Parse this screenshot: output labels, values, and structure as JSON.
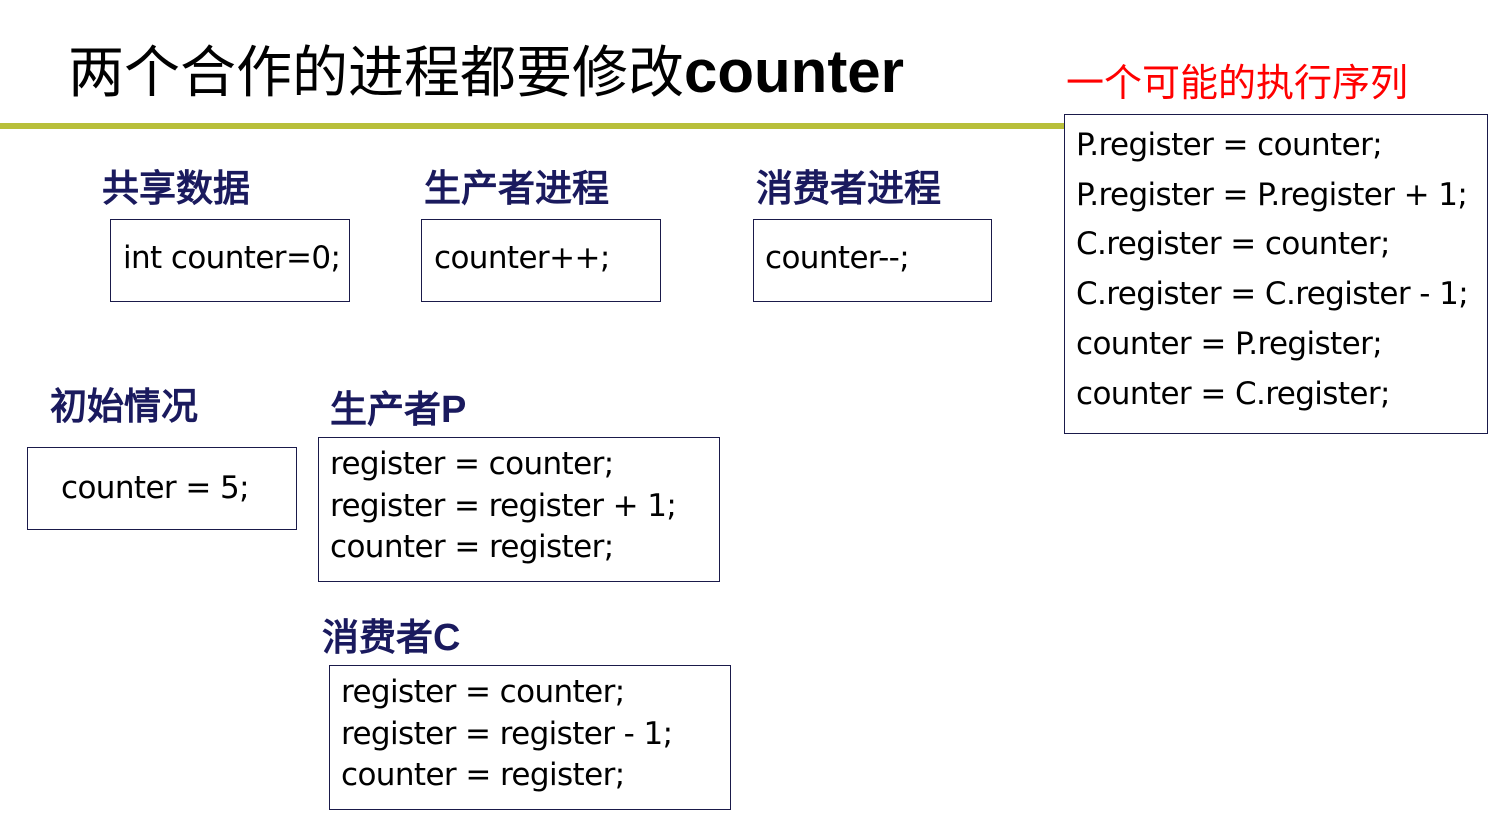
{
  "slide": {
    "title_cjk": "两个合作的进程都要修改",
    "title_latin": "counter"
  },
  "sequence": {
    "heading": "一个可能的执行序列",
    "lines": [
      "P.register = counter;",
      "P.register = P.register + 1;",
      "C.register = counter;",
      "C.register = C.register - 1;",
      "counter = P.register;",
      "counter = C.register;"
    ]
  },
  "shared_data": {
    "label": "共享数据",
    "code": "int counter=0;"
  },
  "producer_process": {
    "label": "生产者进程",
    "code": "counter++;"
  },
  "consumer_process": {
    "label": "消费者进程",
    "code": "counter--;"
  },
  "initial_state": {
    "label": "初始情况",
    "code": "counter = 5;"
  },
  "producer_p": {
    "label_cjk": "生产者",
    "label_latin": "P",
    "lines": [
      "register = counter;",
      "register = register + 1;",
      "counter = register;"
    ]
  },
  "consumer_c": {
    "label_cjk": "消费者",
    "label_latin": "C",
    "lines": [
      "register = counter;",
      "register = register - 1;",
      "counter = register;"
    ]
  },
  "colors": {
    "title_rule": "#b8bf3a",
    "label_text": "#1a1a5e",
    "sequence_heading": "#ff0000",
    "box_border": "#1a1a4a"
  }
}
